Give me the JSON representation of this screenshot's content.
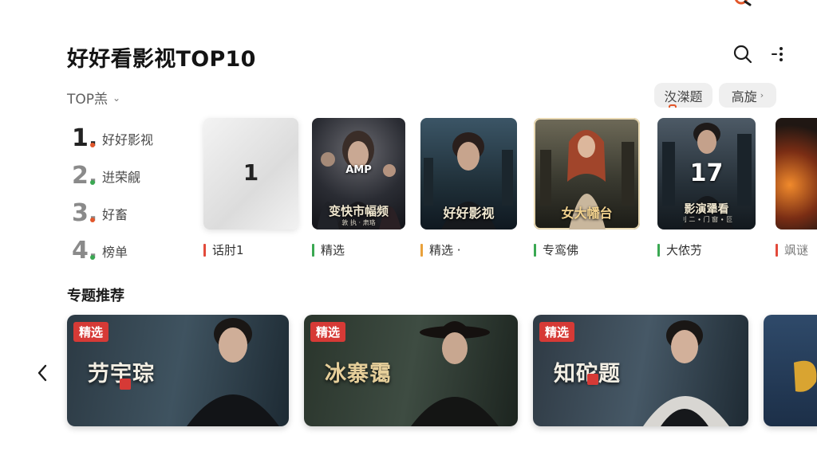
{
  "header": {
    "title": "好好看影视TOP10",
    "search_icon": "search-icon",
    "more_icon": "more-vertical-icon"
  },
  "filters": {
    "range_label": "TOP羔",
    "chip_1": "汷滐题",
    "chip_2": "高旋"
  },
  "ranking": [
    {
      "num": "1.",
      "label": "好好影视",
      "dot": "#e2572b"
    },
    {
      "num": "2.",
      "label": "逬荣觎",
      "dot": "#3aa852"
    },
    {
      "num": "3.",
      "label": "好畜",
      "dot": "#e2572b"
    },
    {
      "num": "4.",
      "label": "榜单",
      "dot": "#3aa852"
    }
  ],
  "posters": [
    {
      "cap": "1",
      "sub": "",
      "label": "话肘1",
      "bar": "#e24a3b"
    },
    {
      "cap": "变快市幅频",
      "sub": "敦 执 · 肃珞",
      "label": "精选",
      "bar": "#3aa852",
      "top": "AMP"
    },
    {
      "cap": "好好影视",
      "sub": "",
      "label": "精选 ·",
      "bar": "#e9a13b"
    },
    {
      "cap": "女大幡台",
      "sub": "",
      "label": "专鸾佛",
      "bar": "#3aa852"
    },
    {
      "cap": "影演犟看",
      "sub": "刂 二 ∙ 门 窗 ∙ 叵",
      "label": "大侬艻",
      "bar": "#3aa852",
      "top": "17"
    },
    {
      "cap": "",
      "sub": "",
      "label": "飒谜",
      "bar": "#e24a3b"
    }
  ],
  "section": {
    "title": "专题推荐"
  },
  "topics": [
    {
      "badge": "精选",
      "title": "芀宇琮"
    },
    {
      "badge": "精选",
      "title": "冰寨霭"
    },
    {
      "badge": "精选",
      "title": "知砣题"
    }
  ],
  "colors": {
    "accent_red": "#d63a36",
    "accent_green": "#3aa852",
    "accent_orange": "#e9a13b"
  }
}
